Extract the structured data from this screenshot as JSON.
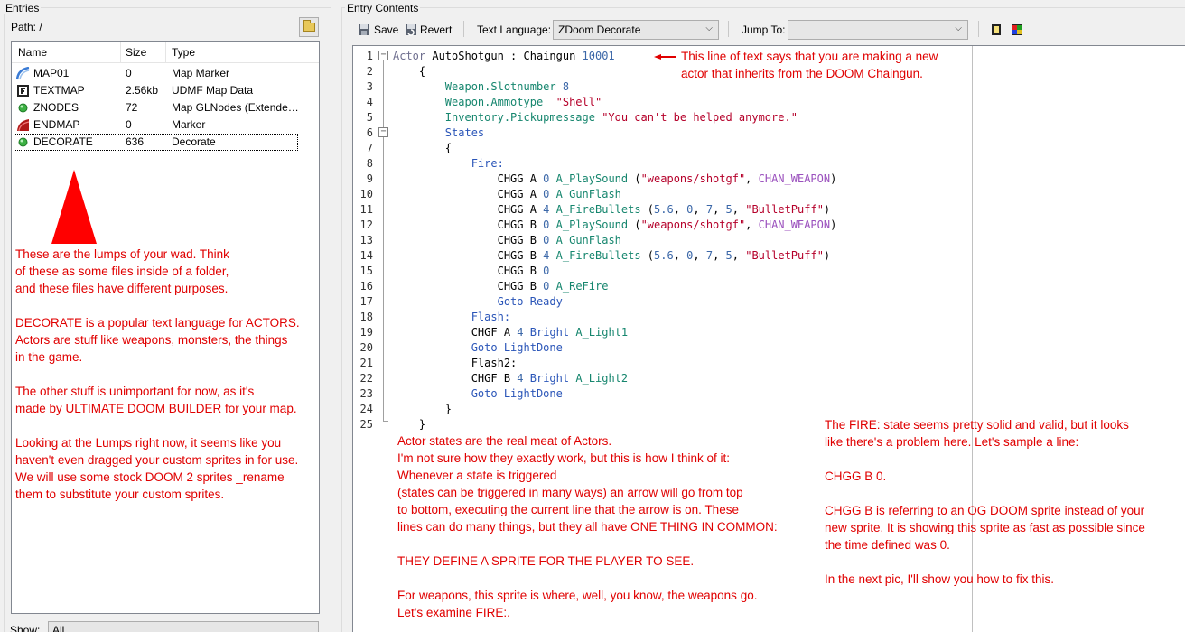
{
  "entries_panel": {
    "title": "Entries",
    "path_label": "Path: /",
    "columns": [
      "Name",
      "Size",
      "Type"
    ],
    "rows": [
      {
        "icon": "map-marker-icon",
        "name": "MAP01",
        "size": "0",
        "type": "Map Marker"
      },
      {
        "icon": "textmap-icon",
        "name": "TEXTMAP",
        "size": "2.56kb",
        "type": "UDMF Map Data"
      },
      {
        "icon": "glnodes-icon",
        "name": "ZNODES",
        "size": "72",
        "type": "Map GLNodes (Extende…"
      },
      {
        "icon": "endmap-icon",
        "name": "ENDMAP",
        "size": "0",
        "type": "Marker"
      },
      {
        "icon": "decorate-icon",
        "name": "DECORATE",
        "size": "636",
        "type": "Decorate"
      }
    ],
    "show_label": "Show:",
    "show_value": "All"
  },
  "contents_panel": {
    "title": "Entry Contents",
    "toolbar": {
      "save_label": "Save",
      "revert_label": "Revert",
      "text_language_label": "Text Language:",
      "text_language_value": "ZDoom Decorate",
      "jump_to_label": "Jump To:",
      "jump_to_value": ""
    }
  },
  "code_lines": [
    {
      "n": "1",
      "parts": [
        [
          "k",
          "Actor "
        ],
        [
          "t",
          "AutoShotgun : Chaingun "
        ],
        [
          "num",
          "10001"
        ]
      ]
    },
    {
      "n": "2",
      "parts": [
        [
          "d",
          "    {"
        ]
      ]
    },
    {
      "n": "3",
      "parts": [
        [
          "d",
          "        "
        ],
        [
          "prop",
          "Weapon.Slotnumber "
        ],
        [
          "num",
          "8"
        ]
      ]
    },
    {
      "n": "4",
      "parts": [
        [
          "d",
          "        "
        ],
        [
          "prop",
          "Weapon.Ammotype  "
        ],
        [
          "str",
          "\"Shell\""
        ]
      ]
    },
    {
      "n": "5",
      "parts": [
        [
          "d",
          "        "
        ],
        [
          "prop",
          "Inventory.Pickupmessage "
        ],
        [
          "str",
          "\"You can't be helped anymore.\""
        ]
      ]
    },
    {
      "n": "6",
      "parts": [
        [
          "d",
          "        "
        ],
        [
          "state",
          "States"
        ]
      ]
    },
    {
      "n": "7",
      "parts": [
        [
          "d",
          "        {"
        ]
      ]
    },
    {
      "n": "8",
      "parts": [
        [
          "d",
          "            "
        ],
        [
          "state",
          "Fire:"
        ]
      ]
    },
    {
      "n": "9",
      "parts": [
        [
          "d",
          "                CHGG A "
        ],
        [
          "num",
          "0"
        ],
        [
          "d",
          " "
        ],
        [
          "fn",
          "A_PlaySound"
        ],
        [
          "d",
          " ("
        ],
        [
          "str",
          "\"weapons/shotgf\""
        ],
        [
          "d",
          ", "
        ],
        [
          "const",
          "CHAN_WEAPON"
        ],
        [
          "d",
          ")"
        ]
      ]
    },
    {
      "n": "10",
      "parts": [
        [
          "d",
          "                CHGG A "
        ],
        [
          "num",
          "0"
        ],
        [
          "d",
          " "
        ],
        [
          "fn",
          "A_GunFlash"
        ]
      ]
    },
    {
      "n": "11",
      "parts": [
        [
          "d",
          "                CHGG A "
        ],
        [
          "num",
          "4"
        ],
        [
          "d",
          " "
        ],
        [
          "fn",
          "A_FireBullets"
        ],
        [
          "d",
          " ("
        ],
        [
          "num",
          "5.6"
        ],
        [
          "d",
          ", "
        ],
        [
          "num",
          "0"
        ],
        [
          "d",
          ", "
        ],
        [
          "num",
          "7"
        ],
        [
          "d",
          ", "
        ],
        [
          "num",
          "5"
        ],
        [
          "d",
          ", "
        ],
        [
          "str",
          "\"BulletPuff\""
        ],
        [
          "d",
          ")"
        ]
      ]
    },
    {
      "n": "12",
      "parts": [
        [
          "d",
          "                CHGG B "
        ],
        [
          "num",
          "0"
        ],
        [
          "d",
          " "
        ],
        [
          "fn",
          "A_PlaySound"
        ],
        [
          "d",
          " ("
        ],
        [
          "str",
          "\"weapons/shotgf\""
        ],
        [
          "d",
          ", "
        ],
        [
          "const",
          "CHAN_WEAPON"
        ],
        [
          "d",
          ")"
        ]
      ]
    },
    {
      "n": "13",
      "parts": [
        [
          "d",
          "                CHGG B "
        ],
        [
          "num",
          "0"
        ],
        [
          "d",
          " "
        ],
        [
          "fn",
          "A_GunFlash"
        ]
      ]
    },
    {
      "n": "14",
      "parts": [
        [
          "d",
          "                CHGG B "
        ],
        [
          "num",
          "4"
        ],
        [
          "d",
          " "
        ],
        [
          "fn",
          "A_FireBullets"
        ],
        [
          "d",
          " ("
        ],
        [
          "num",
          "5.6"
        ],
        [
          "d",
          ", "
        ],
        [
          "num",
          "0"
        ],
        [
          "d",
          ", "
        ],
        [
          "num",
          "7"
        ],
        [
          "d",
          ", "
        ],
        [
          "num",
          "5"
        ],
        [
          "d",
          ", "
        ],
        [
          "str",
          "\"BulletPuff\""
        ],
        [
          "d",
          ")"
        ]
      ]
    },
    {
      "n": "15",
      "parts": [
        [
          "d",
          "                CHGG B "
        ],
        [
          "num",
          "0"
        ]
      ]
    },
    {
      "n": "16",
      "parts": [
        [
          "d",
          "                CHGG B "
        ],
        [
          "num",
          "0"
        ],
        [
          "d",
          " "
        ],
        [
          "fn",
          "A_ReFire"
        ]
      ]
    },
    {
      "n": "17",
      "parts": [
        [
          "d",
          "                "
        ],
        [
          "state",
          "Goto Ready"
        ]
      ]
    },
    {
      "n": "18",
      "parts": [
        [
          "d",
          "            "
        ],
        [
          "state",
          "Flash:"
        ]
      ]
    },
    {
      "n": "19",
      "parts": [
        [
          "d",
          "            CHGF A "
        ],
        [
          "num",
          "4"
        ],
        [
          "d",
          " "
        ],
        [
          "state",
          "Bright"
        ],
        [
          "d",
          " "
        ],
        [
          "fn",
          "A_Light1"
        ]
      ]
    },
    {
      "n": "20",
      "parts": [
        [
          "d",
          "            "
        ],
        [
          "state",
          "Goto LightDone"
        ]
      ]
    },
    {
      "n": "21",
      "parts": [
        [
          "d",
          "            Flash2:"
        ]
      ]
    },
    {
      "n": "22",
      "parts": [
        [
          "d",
          "            CHGF B "
        ],
        [
          "num",
          "4"
        ],
        [
          "d",
          " "
        ],
        [
          "state",
          "Bright"
        ],
        [
          "d",
          " "
        ],
        [
          "fn",
          "A_Light2"
        ]
      ]
    },
    {
      "n": "23",
      "parts": [
        [
          "d",
          "            "
        ],
        [
          "state",
          "Goto LightDone"
        ]
      ]
    },
    {
      "n": "24",
      "parts": [
        [
          "d",
          "        }"
        ]
      ]
    },
    {
      "n": "25",
      "parts": [
        [
          "d",
          "    }"
        ]
      ]
    }
  ],
  "annotations": {
    "top_right": "This line of text says that you are making a new\nactor that inherits from the DOOM Chaingun.",
    "left_panel": "These are the lumps of your wad. Think\nof these as some files inside of a folder,\nand these files have different purposes.\n\nDECORATE is a popular text language for ACTORS.\nActors are stuff like weapons, monsters, the things\nin the game.\n\nThe other stuff is unimportant for now, as it's\nmade by ULTIMATE DOOM BUILDER for your map.\n\nLooking at the Lumps right now, it seems like you\nhaven't even dragged your custom sprites in for use.\nWe will use some stock DOOM 2 sprites _rename\nthem to substitute your custom sprites.",
    "middle": "Actor states are the real meat of Actors.\nI'm not sure how they exactly work, but this is how I think of it:\nWhenever a state is triggered\n(states can be triggered in many ways) an arrow will go from top\nto bottom, executing the current line that the arrow is on. These\nlines can do many things, but they all have ONE THING IN COMMON:\n\nTHEY DEFINE A SPRITE FOR THE PLAYER TO SEE.\n\nFor weapons, this sprite is where, well, you know, the weapons go.\nLet's examine FIRE:.",
    "right": "The FIRE: state seems pretty solid and valid, but it looks\nlike there's a problem here. Let's sample a line:\n\nCHGG B 0.\n\nCHGG B is referring to an OG DOOM sprite instead of your\nnew sprite. It is showing this sprite as fast as possible since\nthe time defined was 0.\n\nIn the next pic, I'll show you how to fix this."
  },
  "colors": {
    "annotation_red": "#e00000",
    "keyword_grey": "#6f6f8f",
    "number_blue": "#3b67a8",
    "property_green": "#16866e",
    "string_red": "#b5002a",
    "state_blue": "#2a55b8",
    "constant_purple": "#9a4fbd"
  }
}
